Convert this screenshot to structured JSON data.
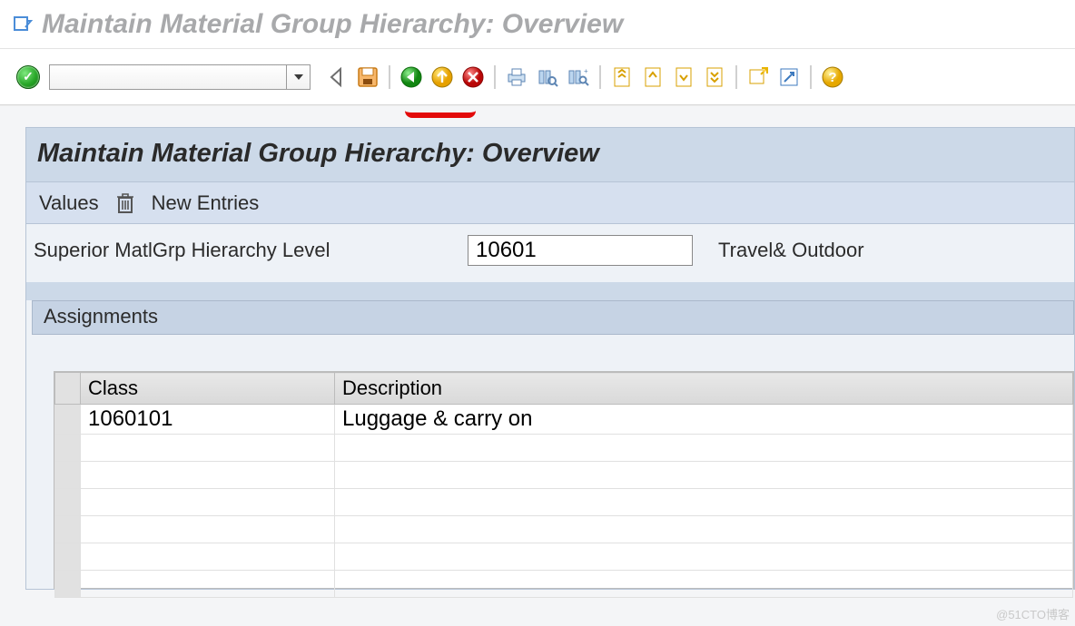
{
  "window": {
    "title": "Maintain Material Group Hierarchy: Overview"
  },
  "panel": {
    "title": "Maintain Material Group Hierarchy: Overview",
    "values_label": "Values",
    "new_entries_label": "New Entries"
  },
  "field": {
    "label": "Superior MatlGrp Hierarchy Level",
    "value": "10601",
    "desc": "Travel& Outdoor"
  },
  "assignments": {
    "section_label": "Assignments",
    "columns": {
      "class": "Class",
      "desc": "Description"
    },
    "rows": [
      {
        "class": "1060101",
        "desc": "Luggage & carry on"
      }
    ]
  },
  "watermark": "@51CTO博客"
}
